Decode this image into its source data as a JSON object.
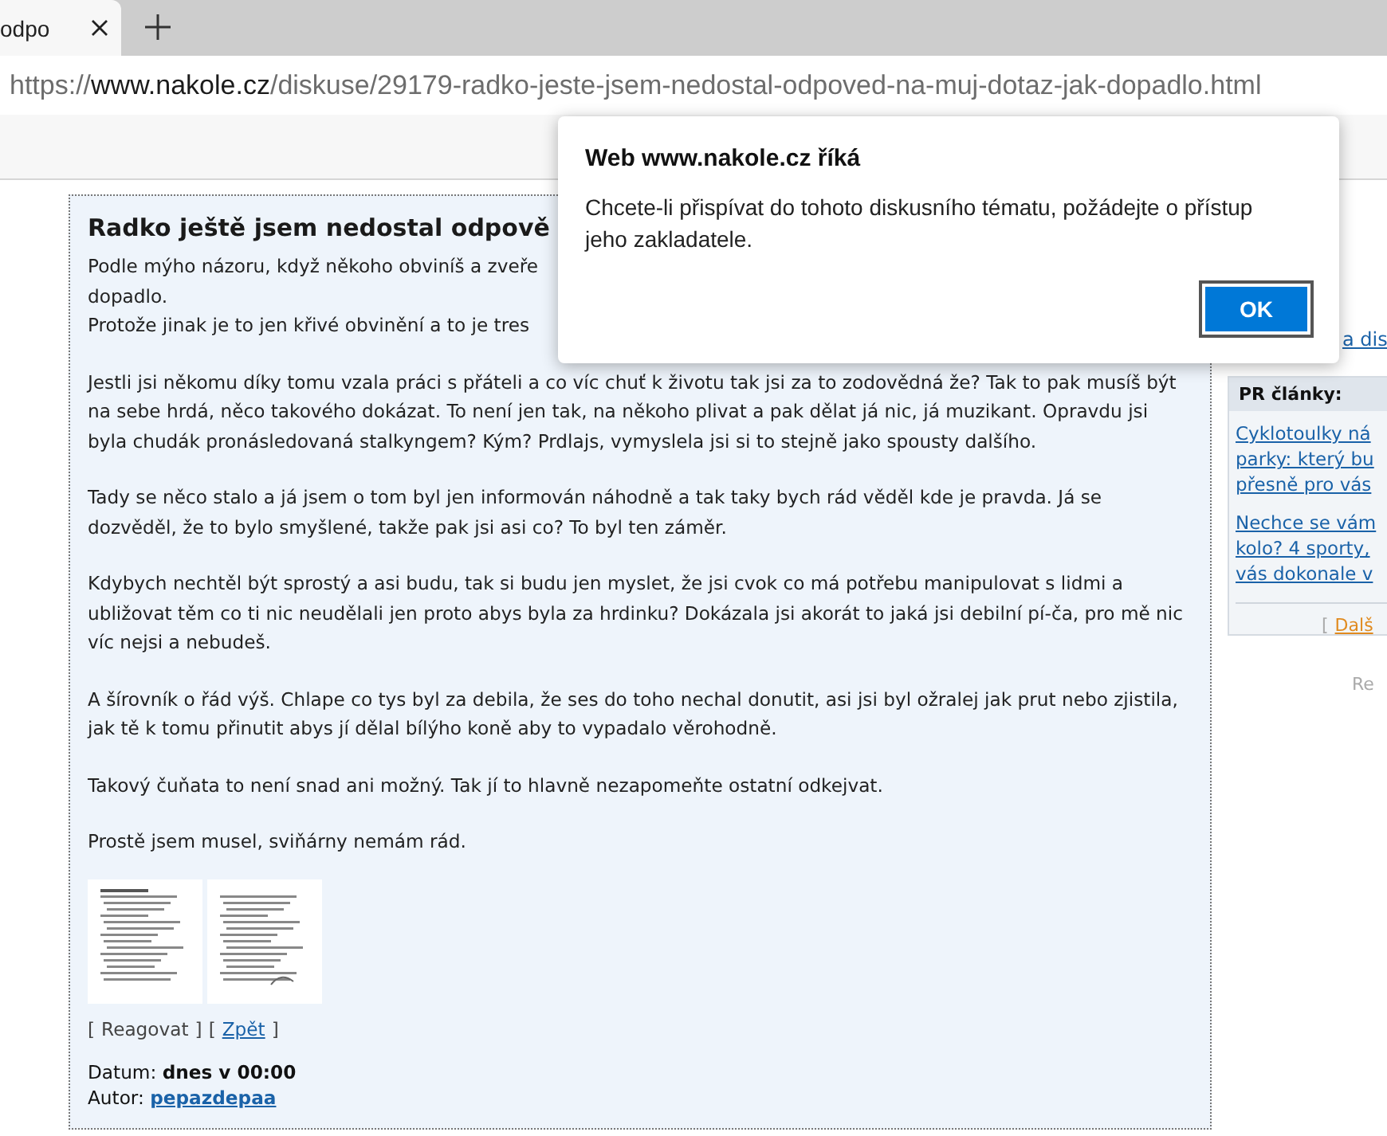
{
  "browser": {
    "tab": {
      "title": "odpo"
    },
    "address": {
      "scheme": "https://",
      "host": "www.nakole.cz",
      "path": "/diskuse/29179-radko-jeste-jsem-nedostal-odpoved-na-muj-dotaz-jak-dopadlo.html"
    }
  },
  "post": {
    "title": "Radko ještě jsem nedostal odpově",
    "first_lines": [
      "Podle mýho názoru, když někoho obviníš a zveře",
      "dopadlo.",
      "Protože jinak je to jen křivé obvinění a to je tres"
    ],
    "paragraphs": [
      "Jestli jsi někomu díky tomu vzala práci s přáteli a co víc chuť k životu tak jsi za to zodovědná že? Tak to pak musíš být na sebe hrdá, něco takového dokázat. To není jen tak, na někoho plivat a pak dělat já nic, já muzikant. Opravdu jsi byla chudák pronásledovaná stalkyngem? Kým? Prdlajs, vymyslela jsi si to stejně jako spousty dalšího.",
      "Tady se něco stalo a já jsem o tom byl jen informován náhodně a tak taky bych rád věděl kde je pravda. Já se dozvěděl, že to bylo smyšlené, takže pak jsi asi co? To byl ten záměr.",
      "Kdybych nechtěl být sprostý a asi budu, tak si budu jen myslet, že jsi cvok co má potřebu manipulovat s lidmi a ubližovat těm co ti nic neudělali jen proto abys byla za hrdinku? Dokázala jsi akorát to jaká jsi debilní pí-ča, pro mě nic víc nejsi a nebudeš.",
      "A šírovník o řád výš. Chlape co tys byl za debila, že ses do toho nechal donutit, asi jsi byl ožralej jak prut nebo zjistila, jak tě k tomu přinutit abys jí dělal bílýho koně aby to vypadalo věrohodně.",
      "Takový čuňata to není snad ani možný. Tak jí to hlavně nezapomeňte ostatní odkejvat.",
      "Prostě jsem musel, sviňárny nemám rád."
    ],
    "actions": [
      {
        "open": "[",
        "label": "Reagovat",
        "close": "]",
        "disabled": true
      },
      {
        "open": "[",
        "label": "Zpět",
        "close": "]",
        "disabled": false
      }
    ],
    "date_label": "Datum:",
    "date": "dnes v 00:00",
    "author_label": "Autor:",
    "author": "pepazdepaa"
  },
  "sidebar": {
    "top_link": "a dis",
    "pr": {
      "title": "PR články:",
      "links": [
        [
          "Cyklotoulky ná",
          "parky: který bu",
          "přesně pro vás"
        ],
        [
          "Nechce se vám",
          "kolo? 4 sporty,",
          "vás dokonale v"
        ]
      ],
      "more_open": "[",
      "more": "Dalš"
    },
    "bottom_text": "Re"
  },
  "dialog": {
    "title": "Web www.nakole.cz říká",
    "message": "Chcete-li přispívat do tohoto diskusního tématu, požádejte o přístup jeho zakladatele.",
    "button": "OK"
  }
}
